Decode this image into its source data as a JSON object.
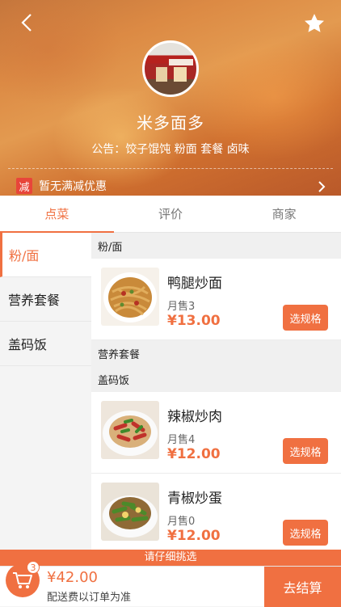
{
  "header": {
    "shop_name": "米多面多",
    "notice": "公告：饺子馄饨 粉面 套餐 卤味",
    "promo_badge": "减",
    "promo_text": "暂无满减优惠"
  },
  "tabs": [
    {
      "label": "点菜",
      "active": true
    },
    {
      "label": "评价",
      "active": false
    },
    {
      "label": "商家",
      "active": false
    }
  ],
  "categories": [
    {
      "label": "粉/面",
      "active": true
    },
    {
      "label": "营养套餐",
      "active": false
    },
    {
      "label": "盖码饭",
      "active": false
    }
  ],
  "menu": {
    "section_noodles": "粉/面",
    "section_set": "营养套餐",
    "section_rice": "盖码饭",
    "items": [
      {
        "name": "鸭腿炒面",
        "sold": "月售3",
        "price": "¥13.00",
        "button": "选规格"
      },
      {
        "name": "辣椒炒肉",
        "sold": "月售4",
        "price": "¥12.00",
        "button": "选规格"
      },
      {
        "name": "青椒炒蛋",
        "sold": "月售0",
        "price": "¥12.00",
        "button": "选规格"
      }
    ]
  },
  "bottom": {
    "hint": "请仔细挑选",
    "cart_count": "3",
    "total": "¥42.00",
    "fee_text": "配送费以订单为准",
    "checkout": "去结算"
  },
  "colors": {
    "accent": "#f07041",
    "promo_badge": "#e8453a"
  },
  "icons": [
    "back-icon",
    "star-icon",
    "chevron-right-icon",
    "cart-icon"
  ]
}
